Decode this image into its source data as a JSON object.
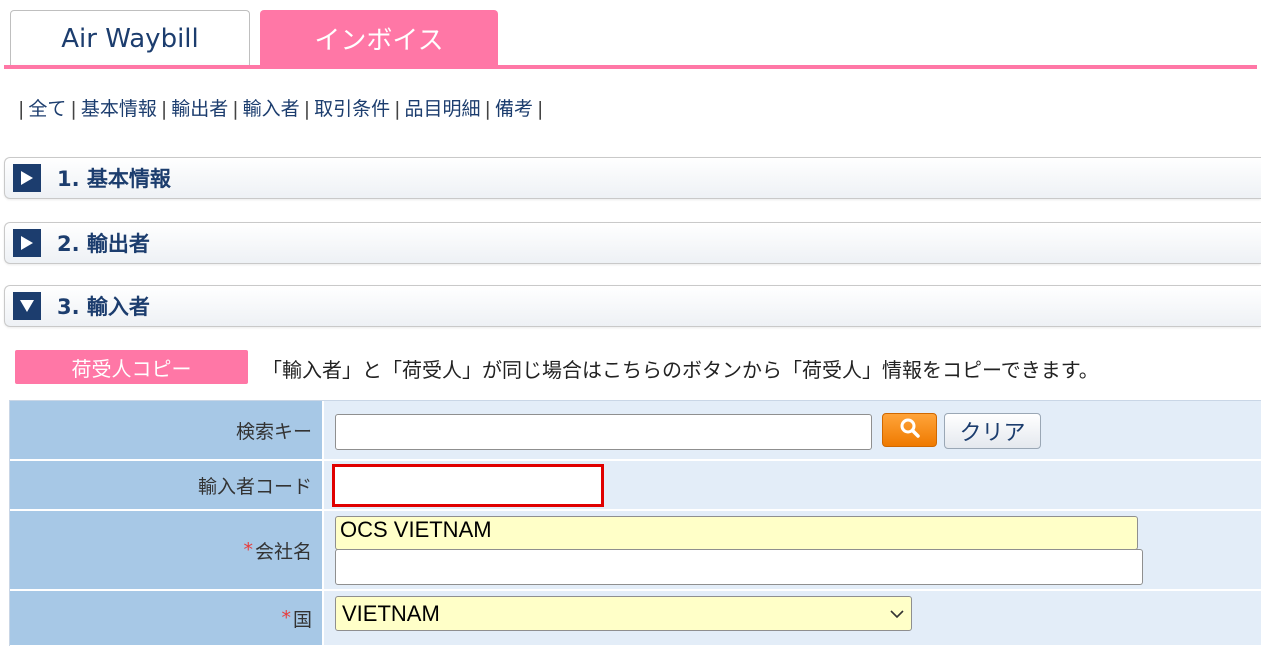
{
  "tabs": {
    "air_waybill": "Air Waybill",
    "invoice": "インボイス"
  },
  "anchor_nav": [
    {
      "label": "全て"
    },
    {
      "label": "基本情報"
    },
    {
      "label": "輸出者"
    },
    {
      "label": "輸入者"
    },
    {
      "label": "取引条件"
    },
    {
      "label": "品目明細"
    },
    {
      "label": "備考"
    }
  ],
  "sections": [
    {
      "title": "1. 基本情報",
      "icon": "play-right-icon",
      "state": "collapsed"
    },
    {
      "title": "2. 輸出者",
      "icon": "play-right-icon",
      "state": "collapsed"
    },
    {
      "title": "3. 輸入者",
      "icon": "play-down-icon",
      "state": "expanded"
    }
  ],
  "copy": {
    "button_label": "荷受人コピー",
    "note": "「輸入者」と「荷受人」が同じ場合はこちらのボタンから「荷受人」情報をコピーできます。"
  },
  "form": {
    "search_key": {
      "label": "検索キー",
      "value": "",
      "clear_label": "クリア",
      "search_icon": "magnifier-icon"
    },
    "importer_code": {
      "label": "輸入者コード",
      "value": ""
    },
    "company_name": {
      "required_mark": "*",
      "label": "会社名",
      "line1": "OCS VIETNAM",
      "line2": ""
    },
    "country": {
      "required_mark": "*",
      "label": "国",
      "value": "VIETNAM"
    }
  },
  "colors": {
    "accent_pink": "#ff77a6",
    "navy": "#1c3d6e",
    "label_bg": "#a7c8e6",
    "value_bg": "#e3edf8",
    "required_field_bg": "#ffffc8",
    "error_border": "#e00000"
  }
}
